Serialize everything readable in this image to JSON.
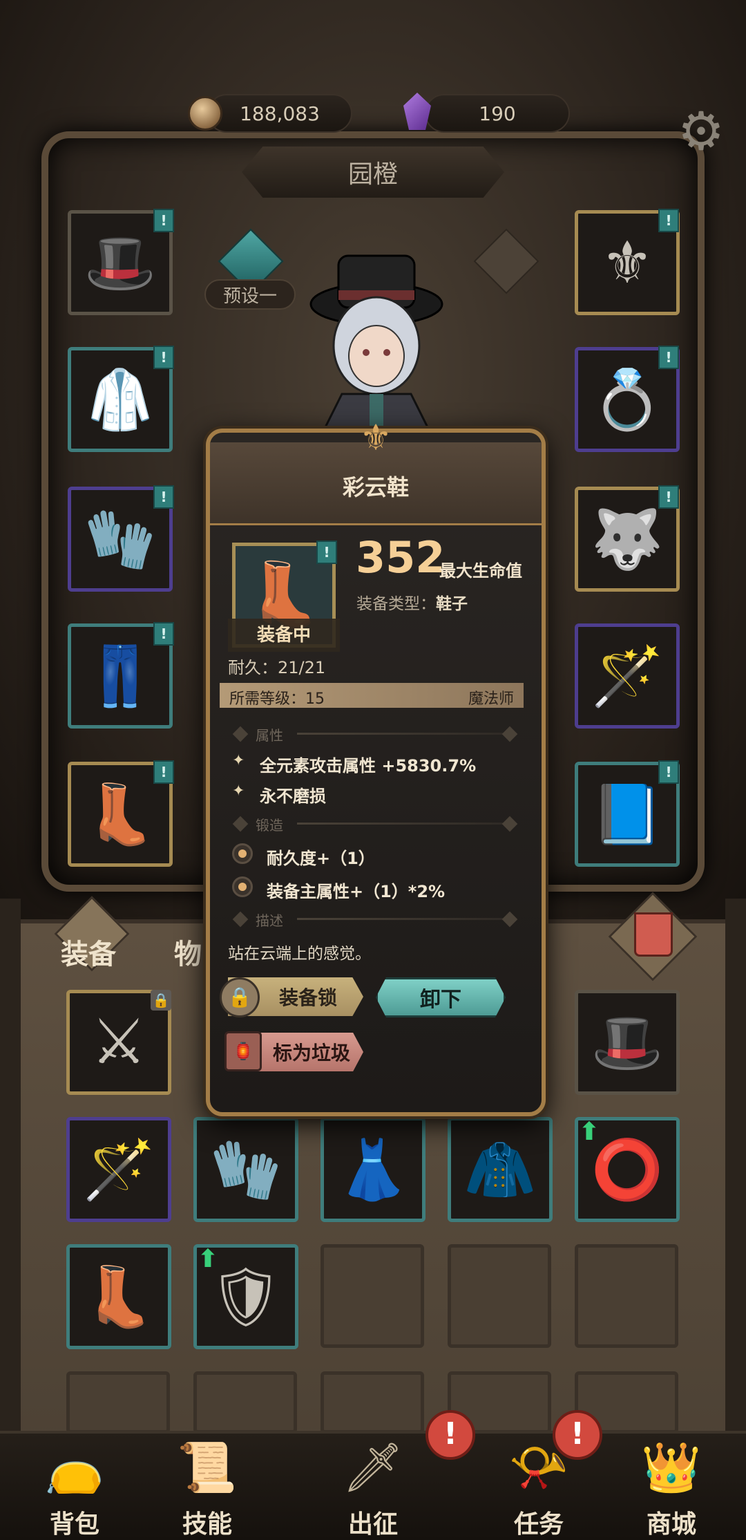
{
  "currency": {
    "gold": "188,083",
    "gems": "190"
  },
  "character": {
    "name": "园橙",
    "preset_label": "预设一"
  },
  "icons": {
    "gold": "coin-icon",
    "gems": "purple-gem-icon",
    "settings": "gear-icon",
    "lock": "padlock-icon",
    "trash": "trash-can-icon",
    "upgrade": "green-up-arrow-icon"
  },
  "colors": {
    "accent_gold": "#a37d47",
    "teal_button": "#7fd0c6",
    "pink_button": "#d79a8f",
    "stat_number": "#f5cf96",
    "alert_red": "#d2493e"
  },
  "equipment_left": [
    {
      "name": "top-hat",
      "glyph": "🎩"
    },
    {
      "name": "vest",
      "glyph": "🥼"
    },
    {
      "name": "glove",
      "glyph": "🧤"
    },
    {
      "name": "pants",
      "glyph": "👖"
    },
    {
      "name": "boots",
      "glyph": "👢"
    }
  ],
  "equipment_right": [
    {
      "name": "amulet",
      "glyph": "⚜"
    },
    {
      "name": "ring",
      "glyph": "💍"
    },
    {
      "name": "cloak",
      "glyph": "🐺"
    },
    {
      "name": "wand",
      "glyph": "🪄"
    },
    {
      "name": "spellbook",
      "glyph": "📘"
    }
  ],
  "inventory_tabs": {
    "equipment": "装备",
    "items": "物"
  },
  "tooltip": {
    "title": "彩云鞋",
    "stat_value": "352",
    "stat_name": "最大生命值",
    "type_label": "装备类型：",
    "type_value": "鞋子",
    "equipped_badge": "装备中",
    "durability": "耐久：21/21",
    "required_level": "所需等级：15",
    "class": "魔法师",
    "attributes_header": "属性",
    "attributes": [
      "全元素攻击属性 +5830.7%",
      "永不磨损"
    ],
    "forge_header": "锻造",
    "forge": [
      "耐久度+（1）",
      "装备主属性+（1）*2%"
    ],
    "desc_header": "描述",
    "description": "站在云端上的感觉。",
    "lock_button": "装备锁",
    "unequip_button": "卸下",
    "trash_button": "标为垃圾"
  },
  "nav": [
    {
      "label": "背包",
      "icon": "bag-icon",
      "glyph": "👝"
    },
    {
      "label": "技能",
      "icon": "skill-book-icon",
      "glyph": "📜"
    },
    {
      "label": "出征",
      "icon": "sword-map-icon",
      "glyph": "🗡"
    },
    {
      "label": "任务",
      "icon": "scroll-icon",
      "glyph": "📯"
    },
    {
      "label": "商城",
      "icon": "crown-shop-icon",
      "glyph": "👑"
    }
  ]
}
